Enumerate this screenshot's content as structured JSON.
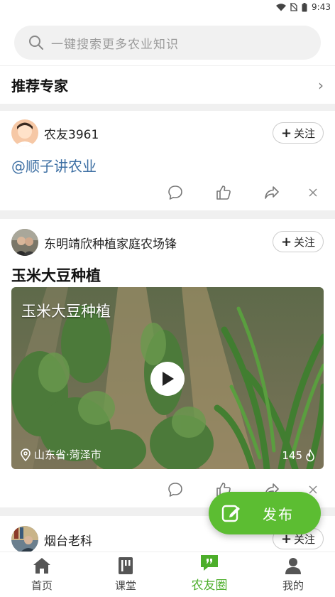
{
  "status_bar": {
    "time": "9:43"
  },
  "search": {
    "placeholder": "一键搜索更多农业知识"
  },
  "experts": {
    "title": "推荐专家",
    "chevron": "›"
  },
  "posts": [
    {
      "author": "农友3961",
      "follow_label": "关注",
      "content": "@顺子讲农业"
    },
    {
      "author": "东明靖欣种植家庭农场锋",
      "follow_label": "关注",
      "title": "玉米大豆种植",
      "video": {
        "overlay_title": "玉米大豆种植",
        "location": "山东省·菏泽市",
        "views": "145"
      }
    },
    {
      "author": "烟台老科",
      "follow_label": "关注"
    }
  ],
  "fab": {
    "label": "发布",
    "icon": "edit-icon"
  },
  "tabbar": [
    {
      "label": "首页",
      "icon": "home-icon"
    },
    {
      "label": "课堂",
      "icon": "book-icon"
    },
    {
      "label": "农友圈",
      "icon": "chat-quote-icon"
    },
    {
      "label": "我的",
      "icon": "user-icon"
    }
  ],
  "colors": {
    "accent": "#5cbd32",
    "active_tab": "#4cae2a",
    "mention": "#3d6fa3"
  }
}
